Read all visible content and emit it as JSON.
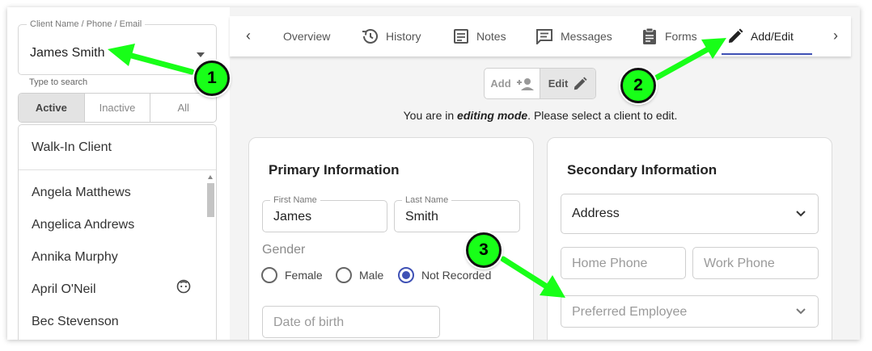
{
  "client_selector": {
    "label": "Client Name / Phone / Email",
    "value": "James Smith",
    "helper": "Type to search"
  },
  "status_filter": {
    "options": [
      "Active",
      "Inactive",
      "All"
    ],
    "selected": "Active"
  },
  "client_list": {
    "walk_in": "Walk-In Client",
    "items": [
      "Angela Matthews",
      "Angelica Andrews",
      "Annika Murphy",
      "April O'Neil",
      "Bec Stevenson"
    ]
  },
  "tabs": {
    "items": [
      {
        "label": "Overview",
        "icon": "overview-icon"
      },
      {
        "label": "History",
        "icon": "history-icon"
      },
      {
        "label": "Notes",
        "icon": "notes-icon"
      },
      {
        "label": "Messages",
        "icon": "messages-icon"
      },
      {
        "label": "Forms",
        "icon": "clipboard-icon"
      },
      {
        "label": "Add/Edit",
        "icon": "pencil-icon"
      }
    ],
    "active": "Add/Edit"
  },
  "mode_toggle": {
    "add_label": "Add",
    "edit_label": "Edit",
    "active": "Edit"
  },
  "mode_message": {
    "prefix": "You are in ",
    "emphasis": "editing mode",
    "suffix": ". Please select a client to edit."
  },
  "primary_info": {
    "title": "Primary Information",
    "first_name_label": "First Name",
    "first_name": "James",
    "last_name_label": "Last Name",
    "last_name": "Smith",
    "gender_label": "Gender",
    "gender_options": [
      "Female",
      "Male",
      "Not Recorded"
    ],
    "gender_selected": "Not Recorded",
    "dob_placeholder": "Date of birth"
  },
  "secondary_info": {
    "title": "Secondary Information",
    "address_label": "Address",
    "home_phone_placeholder": "Home Phone",
    "work_phone_placeholder": "Work Phone",
    "preferred_employee_placeholder": "Preferred Employee"
  },
  "annotations": {
    "badges": [
      "1",
      "2",
      "3"
    ],
    "color": "#18ff18"
  },
  "colors": {
    "accent": "#3f51b5"
  }
}
